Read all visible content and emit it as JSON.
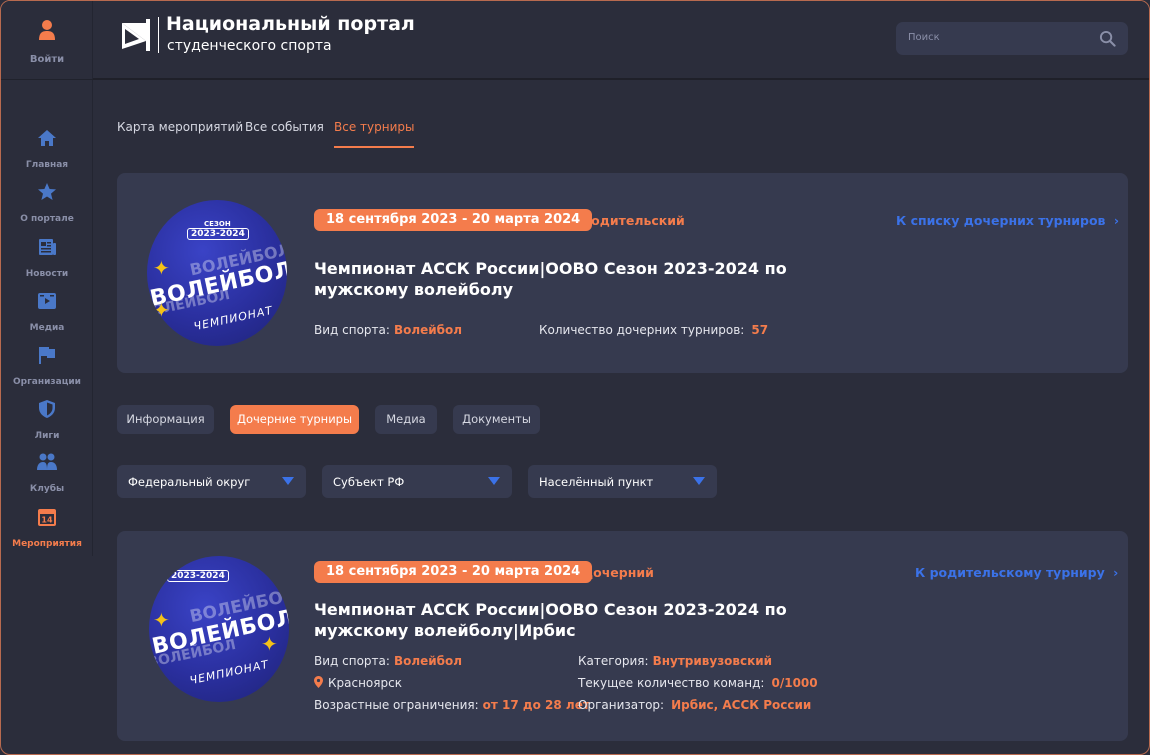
{
  "sidebar": {
    "login": "Войти",
    "items": [
      {
        "label": "Главная",
        "icon": "home-icon"
      },
      {
        "label": "О портале",
        "icon": "star-icon"
      },
      {
        "label": "Новости",
        "icon": "newspaper-icon"
      },
      {
        "label": "Медиа",
        "icon": "media-icon"
      },
      {
        "label": "Организации",
        "icon": "flag-icon"
      },
      {
        "label": "Лиги",
        "icon": "shield-icon"
      },
      {
        "label": "Клубы",
        "icon": "users-icon"
      },
      {
        "label": "Мероприятия",
        "icon": "calendar-icon",
        "badge": "14",
        "active": true
      }
    ]
  },
  "header": {
    "title": "Национальный портал",
    "subtitle": "студенческого спорта",
    "search_placeholder": "Поиск"
  },
  "tabs": [
    {
      "label": "Карта мероприятий"
    },
    {
      "label": "Все события"
    },
    {
      "label": "Все турниры",
      "active": true
    }
  ],
  "parent_card": {
    "emblem": {
      "season": "СЕЗОН",
      "years": "2023-2024",
      "word": "ВОЛЕЙБОЛ",
      "champ": "ЧЕМПИОНАТ"
    },
    "dates": "18 сентября 2023 - 20 марта 2024",
    "tag": "Родительский",
    "link": "К списку дочерних турниров",
    "title": "Чемпионат АССК России|ООВО Сезон 2023-2024 по мужскому волейболу",
    "sport_label": "Вид спорта:",
    "sport_value": "Волейбол",
    "children_label": "Количество дочерних турниров:",
    "children_value": "57"
  },
  "section_buttons": [
    {
      "label": "Информация"
    },
    {
      "label": "Дочерние турниры",
      "active": true
    },
    {
      "label": "Медиа"
    },
    {
      "label": "Документы"
    }
  ],
  "filters": [
    {
      "label": "Федеральный округ"
    },
    {
      "label": "Субъект РФ"
    },
    {
      "label": "Населённый пункт"
    }
  ],
  "child_card": {
    "emblem": {
      "years": "2023-2024",
      "word": "ВОЛЕЙБОЛ",
      "champ": "ЧЕМПИОНАТ"
    },
    "dates": "18 сентября 2023 - 20 марта 2024",
    "tag": "Дочерний",
    "link": "К родительскому турниру",
    "title": "Чемпионат АССК России|ООВО Сезон 2023-2024 по мужскому волейболу|Ирбис",
    "sport_label": "Вид спорта:",
    "sport_value": "Волейбол",
    "city": "Красноярск",
    "age_label": "Возрастные ограничения:",
    "age_value": "от 17 до 28 лет",
    "category_label": "Категория:",
    "category_value": "Внутривузовский",
    "teams_label": "Текущее количество команд:",
    "teams_value": "0/1000",
    "organizer_label": "Организатор:",
    "organizer_value": "Ирбис, АССК России"
  },
  "colors": {
    "accent": "#f47c4c",
    "link": "#3b72e8",
    "card_bg": "#363a4f",
    "page_bg": "#2b2d3b"
  }
}
